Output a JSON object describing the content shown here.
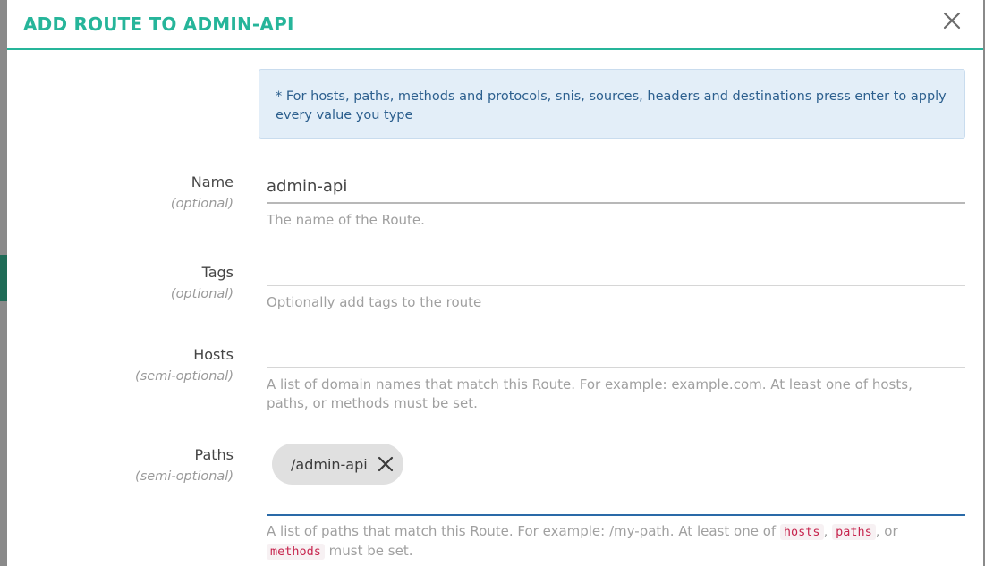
{
  "modal": {
    "title": "ADD ROUTE TO ADMIN-API",
    "close_icon": "close-icon",
    "accent_color": "#26b59a"
  },
  "notice": {
    "text": "* For hosts, paths, methods and protocols, snis, sources, headers and destinations press enter to apply every value you type"
  },
  "fields": {
    "name": {
      "label": "Name",
      "sublabel": "(optional)",
      "value": "admin-api",
      "help": "The name of the Route."
    },
    "tags": {
      "label": "Tags",
      "sublabel": "(optional)",
      "value": "",
      "help": "Optionally add tags to the route"
    },
    "hosts": {
      "label": "Hosts",
      "sublabel": "(semi-optional)",
      "value": "",
      "help": "A list of domain names that match this Route. For example: example.com. At least one of hosts, paths, or methods must be set."
    },
    "paths": {
      "label": "Paths",
      "sublabel": "(semi-optional)",
      "chips": [
        "/admin-api"
      ],
      "help_prefix": "A list of paths that match this Route. For example: /my-path. At least one of ",
      "help_code_1": "hosts",
      "help_sep_1": ", ",
      "help_code_2": "paths",
      "help_sep_2": ", or ",
      "help_code_3": "methods",
      "help_suffix": " must be set."
    }
  }
}
